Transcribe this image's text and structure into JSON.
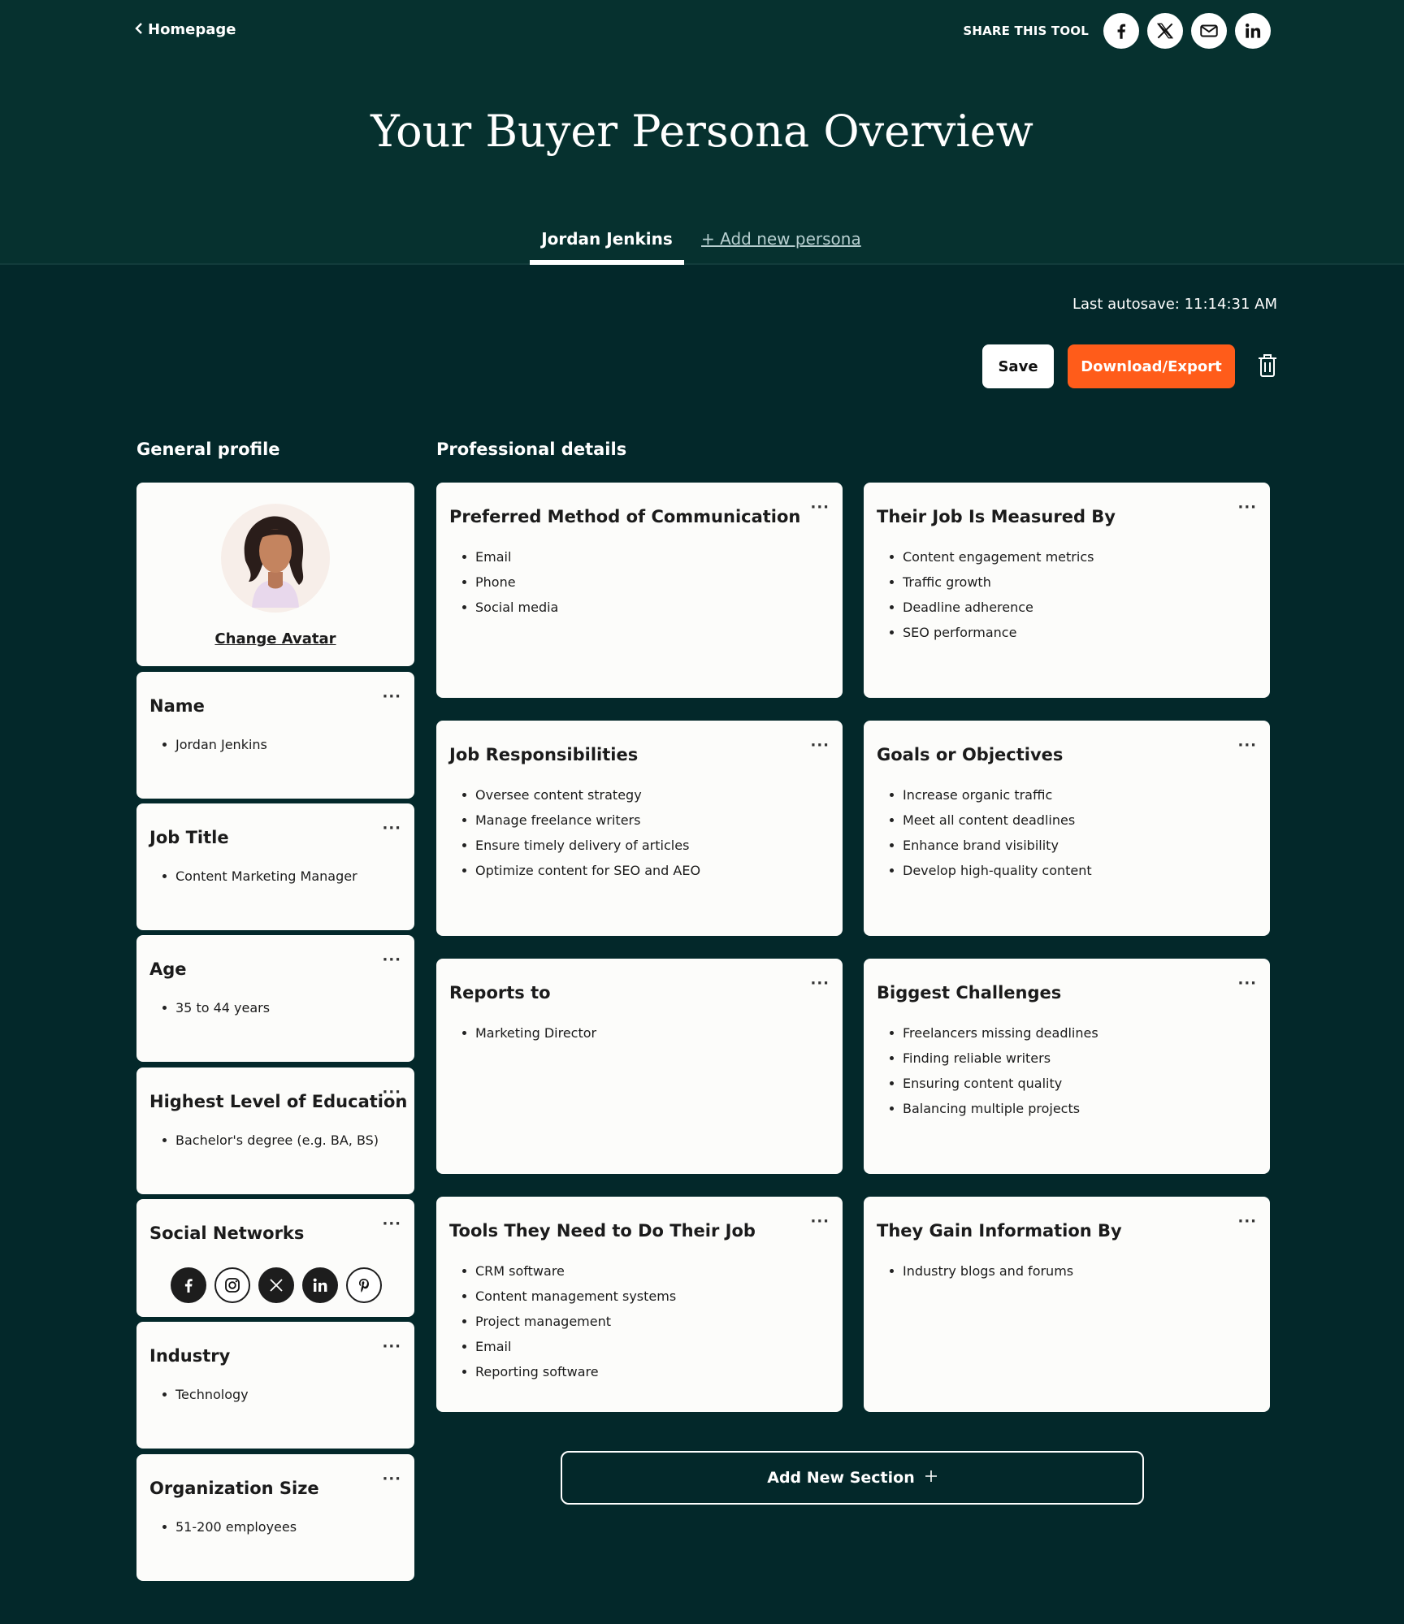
{
  "header": {
    "back_label": "Homepage",
    "share_label": "SHARE THIS TOOL",
    "title": "Your Buyer Persona Overview",
    "tabs": [
      {
        "label": "Jordan Jenkins"
      },
      {
        "label": "+ Add new persona"
      }
    ]
  },
  "toolbar": {
    "autosave": "Last autosave: 11:14:31 AM",
    "save_label": "Save",
    "export_label": "Download/Export"
  },
  "general": {
    "heading": "General profile",
    "change_avatar": "Change Avatar",
    "cards": {
      "name": {
        "title": "Name",
        "items": [
          "Jordan Jenkins"
        ]
      },
      "job_title": {
        "title": "Job Title",
        "items": [
          "Content Marketing Manager"
        ]
      },
      "age": {
        "title": "Age",
        "items": [
          "35 to 44 years"
        ]
      },
      "education": {
        "title": "Highest Level of Education",
        "items": [
          "Bachelor's degree (e.g. BA, BS)"
        ]
      },
      "social": {
        "title": "Social Networks"
      },
      "industry": {
        "title": "Industry",
        "items": [
          "Technology"
        ]
      },
      "org_size": {
        "title": "Organization Size",
        "items": [
          "51-200 employees"
        ]
      }
    }
  },
  "professional": {
    "heading": "Professional details",
    "cards": {
      "communication": {
        "title": "Preferred Method of Communication",
        "items": [
          "Email",
          "Phone",
          "Social media"
        ]
      },
      "measured": {
        "title": "Their Job Is Measured By",
        "items": [
          "Content engagement metrics",
          "Traffic growth",
          "Deadline adherence",
          "SEO performance"
        ]
      },
      "responsibilities": {
        "title": "Job Responsibilities",
        "items": [
          "Oversee content strategy",
          "Manage freelance writers",
          "Ensure timely delivery of articles",
          "Optimize content for SEO and AEO"
        ]
      },
      "goals": {
        "title": "Goals or Objectives",
        "items": [
          "Increase organic traffic",
          "Meet all content deadlines",
          "Enhance brand visibility",
          "Develop high-quality content"
        ]
      },
      "reports": {
        "title": "Reports to",
        "items": [
          "Marketing Director"
        ]
      },
      "challenges": {
        "title": "Biggest Challenges",
        "items": [
          "Freelancers missing deadlines",
          "Finding reliable writers",
          "Ensuring content quality",
          "Balancing multiple projects"
        ]
      },
      "tools": {
        "title": "Tools They Need to Do Their Job",
        "items": [
          "CRM software",
          "Content management systems",
          "Project management",
          "Email",
          "Reporting software"
        ]
      },
      "info": {
        "title": "They Gain Information By",
        "items": [
          "Industry blogs and forums"
        ]
      }
    }
  },
  "menu_glyph": "···",
  "add_section_label": "Add New Section",
  "colors": {
    "background": "#03282a",
    "header": "#06312f",
    "accent": "#ff5c1a",
    "card": "#fcfcfa"
  }
}
